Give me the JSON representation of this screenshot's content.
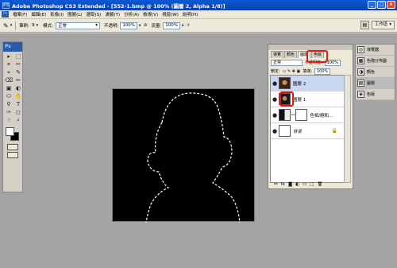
{
  "window": {
    "title": "Adobe Photoshop CS3 Extended - [552-1.bmp @ 100% (圖層 2, Alpha 1/8)]",
    "app_icon": "PS",
    "controls": [
      "_",
      "□",
      "×"
    ]
  },
  "menubar": {
    "ps_icon": "Ps",
    "items": [
      "檔案(F)",
      "編輯(E)",
      "影像(I)",
      "圖層(L)",
      "選取(S)",
      "濾鏡(T)",
      "分析(A)",
      "檢視(V)",
      "視窗(W)",
      "說明(H)"
    ]
  },
  "options": {
    "brush_label": "筆刷:",
    "brush_size": "9",
    "mode_label": "模式:",
    "mode_value": "正常",
    "opacity_label": "不透明:",
    "opacity_value": "100%",
    "flow_label": "流量:",
    "flow_value": "100%",
    "workspace_label": "工作區 ▾"
  },
  "toolbox": {
    "logo": "Ps",
    "tools": [
      "▸",
      "⬚",
      "⌗",
      "✂",
      "⌖",
      "✎",
      "⌫",
      "✏",
      "▣",
      "◐",
      "⬭",
      "✋",
      "⚲",
      "T",
      "✑",
      "◻",
      "☝",
      "⌕"
    ]
  },
  "layers_panel": {
    "tabs": [
      "導覽",
      "顏色",
      "圖層",
      "色版"
    ],
    "blend_mode": "正常",
    "opacity_label": "不透明度:",
    "opacity_value": "100%",
    "lock_label": "鎖定:",
    "fill_label": "填滿:",
    "fill_value": "100%",
    "layers": [
      {
        "name": "圖層 2",
        "visible": "●"
      },
      {
        "name": "圖層 1",
        "visible": "●"
      },
      {
        "name": "色相/飽和...",
        "visible": "●"
      },
      {
        "name": "背景",
        "visible": "●",
        "lock": "🔒"
      }
    ],
    "footer_icons": [
      "⚯",
      "fx",
      "◙",
      "◐",
      "▭",
      "▢",
      "🗑"
    ]
  },
  "dock": {
    "items": [
      {
        "label": "導覽器",
        "icon": "◎"
      },
      {
        "label": "色階分佈圖",
        "icon": "▦"
      },
      {
        "label": "顏色",
        "icon": "◑"
      },
      {
        "label": "圖層",
        "icon": "▤"
      },
      {
        "label": "色版",
        "icon": "◈"
      }
    ]
  }
}
